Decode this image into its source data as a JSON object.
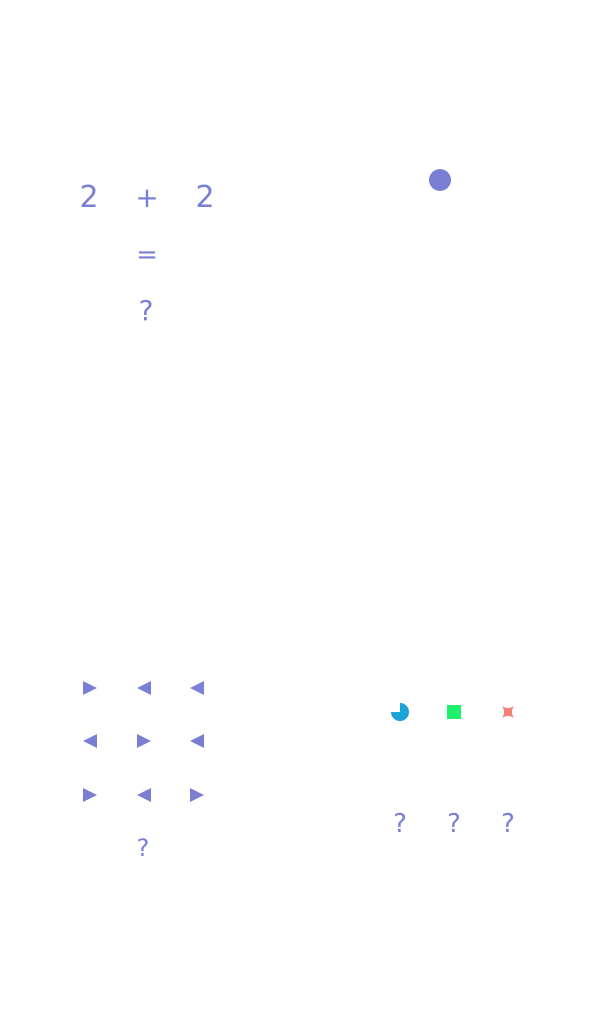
{
  "equation": {
    "left": "2",
    "operator": "+",
    "right": "2",
    "equals": "=",
    "result": "?"
  },
  "indicator": {
    "icon": "circle-dot-icon",
    "color": "#7b7fd4"
  },
  "pattern_grid": {
    "rows": [
      [
        "right",
        "left",
        "left"
      ],
      [
        "left",
        "right",
        "left"
      ],
      [
        "right",
        "left",
        "right"
      ]
    ],
    "missing": "?"
  },
  "options": {
    "shapes": [
      {
        "icon": "three-quarter-pie-icon",
        "color": "#1aa3d6"
      },
      {
        "icon": "square-icon",
        "color": "#1df06b"
      },
      {
        "icon": "concave-star-icon",
        "color": "#f4807a"
      }
    ],
    "answers": [
      "?",
      "?",
      "?"
    ]
  },
  "colors": {
    "primary": "#7b7fd4",
    "background": "#ffffff"
  }
}
